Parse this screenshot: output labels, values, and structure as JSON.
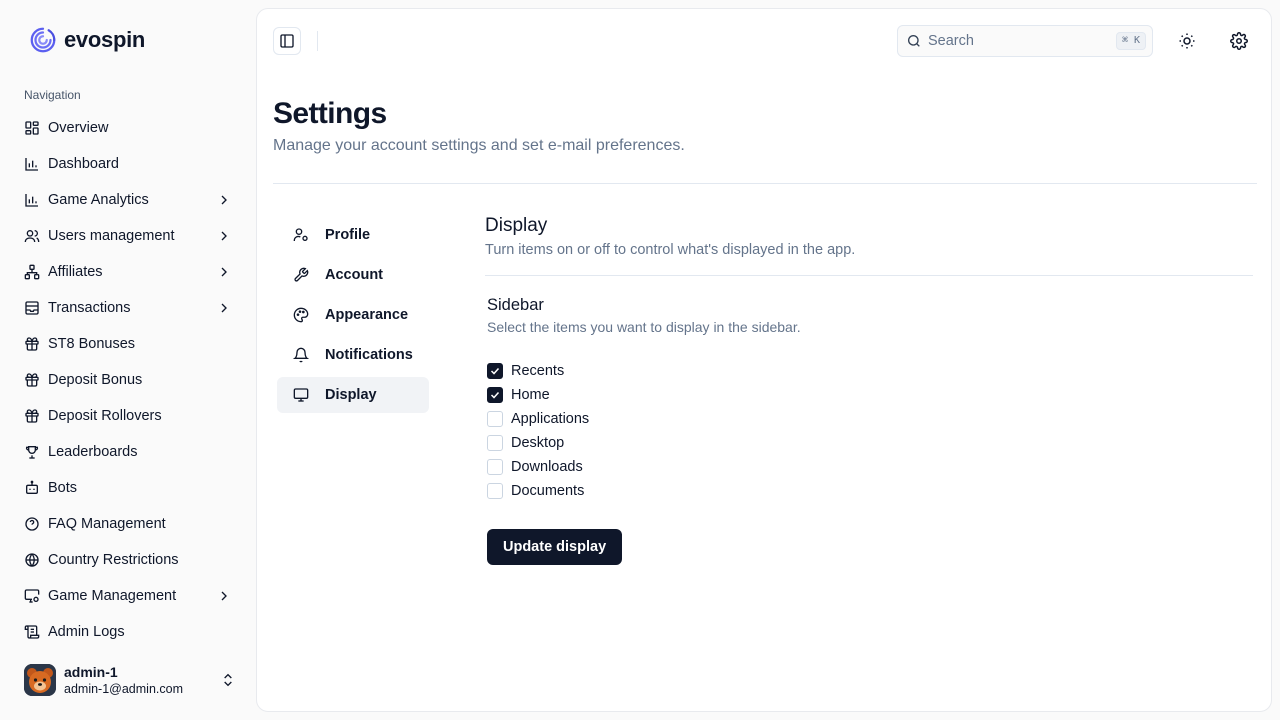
{
  "brand": {
    "name": "evospin",
    "logo_icon": "spiral-logo-icon",
    "accent": "#5b5ff0"
  },
  "sidebar": {
    "section_label": "Navigation",
    "items": [
      {
        "label": "Overview",
        "icon": "layout-grid-icon",
        "has_children": false
      },
      {
        "label": "Dashboard",
        "icon": "bar-chart-icon",
        "has_children": false
      },
      {
        "label": "Game Analytics",
        "icon": "bar-chart-icon",
        "has_children": true
      },
      {
        "label": "Users management",
        "icon": "users-icon",
        "has_children": true
      },
      {
        "label": "Affiliates",
        "icon": "network-icon",
        "has_children": true
      },
      {
        "label": "Transactions",
        "icon": "archive-icon",
        "has_children": true
      },
      {
        "label": "ST8 Bonuses",
        "icon": "gift-icon",
        "has_children": false
      },
      {
        "label": "Deposit Bonus",
        "icon": "gift-icon",
        "has_children": false
      },
      {
        "label": "Deposit Rollovers",
        "icon": "gift-icon",
        "has_children": false
      },
      {
        "label": "Leaderboards",
        "icon": "trophy-icon",
        "has_children": false
      },
      {
        "label": "Bots",
        "icon": "bot-icon",
        "has_children": false
      },
      {
        "label": "FAQ Management",
        "icon": "help-circle-icon",
        "has_children": false
      },
      {
        "label": "Country Restrictions",
        "icon": "globe-icon",
        "has_children": false
      },
      {
        "label": "Game Management",
        "icon": "monitor-cog-icon",
        "has_children": true
      },
      {
        "label": "Admin Logs",
        "icon": "scroll-icon",
        "has_children": false
      }
    ],
    "user": {
      "name": "admin-1",
      "email": "admin-1@admin.com"
    }
  },
  "header": {
    "search": {
      "placeholder": "Search",
      "shortcut": "⌘ K"
    }
  },
  "page": {
    "title": "Settings",
    "subtitle": "Manage your account settings and set e-mail preferences."
  },
  "settings_nav": [
    {
      "label": "Profile",
      "icon": "user-cog-icon",
      "active": false
    },
    {
      "label": "Account",
      "icon": "wrench-icon",
      "active": false
    },
    {
      "label": "Appearance",
      "icon": "palette-icon",
      "active": false
    },
    {
      "label": "Notifications",
      "icon": "bell-icon",
      "active": false
    },
    {
      "label": "Display",
      "icon": "monitor-icon",
      "active": true
    }
  ],
  "display": {
    "title": "Display",
    "subtitle": "Turn items on or off to control what's displayed in the app.",
    "sidebar_group": {
      "title": "Sidebar",
      "subtitle": "Select the items you want to display in the sidebar.",
      "options": [
        {
          "label": "Recents",
          "checked": true
        },
        {
          "label": "Home",
          "checked": true
        },
        {
          "label": "Applications",
          "checked": false
        },
        {
          "label": "Desktop",
          "checked": false
        },
        {
          "label": "Downloads",
          "checked": false
        },
        {
          "label": "Documents",
          "checked": false
        }
      ]
    },
    "submit_label": "Update display"
  }
}
